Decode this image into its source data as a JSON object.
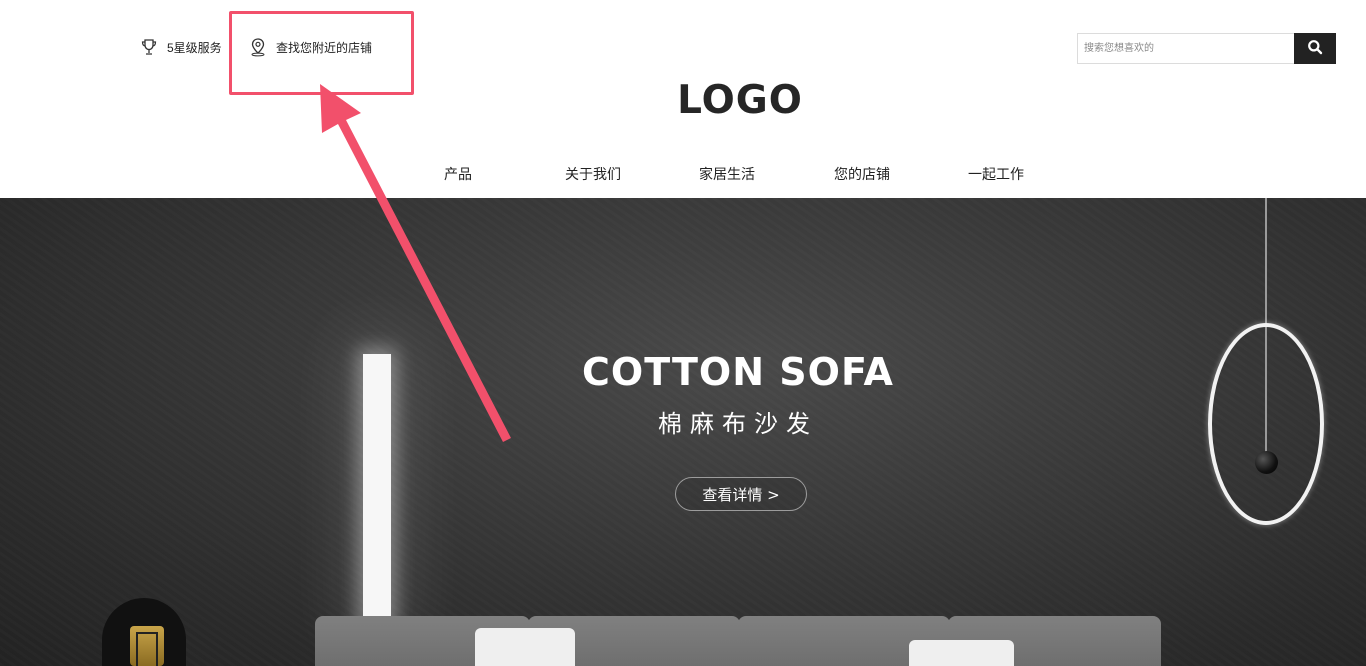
{
  "header": {
    "service_label": "5星级服务",
    "store_finder_label": "查找您附近的店铺",
    "logo_text": "LOGO",
    "search": {
      "placeholder": "搜索您想喜欢的",
      "button_icon": "search-icon"
    }
  },
  "nav": {
    "items": [
      {
        "label": "产品"
      },
      {
        "label": "关于我们"
      },
      {
        "label": "家居生活"
      },
      {
        "label": "您的店铺"
      },
      {
        "label": "一起工作"
      }
    ]
  },
  "hero": {
    "title": "COTTON SOFA",
    "subtitle": "棉麻布沙发",
    "cta_label": "查看详情 >"
  },
  "annotation": {
    "color": "#f2506b"
  },
  "icons": {
    "service": "trophy-icon",
    "store": "location-pin-icon"
  }
}
